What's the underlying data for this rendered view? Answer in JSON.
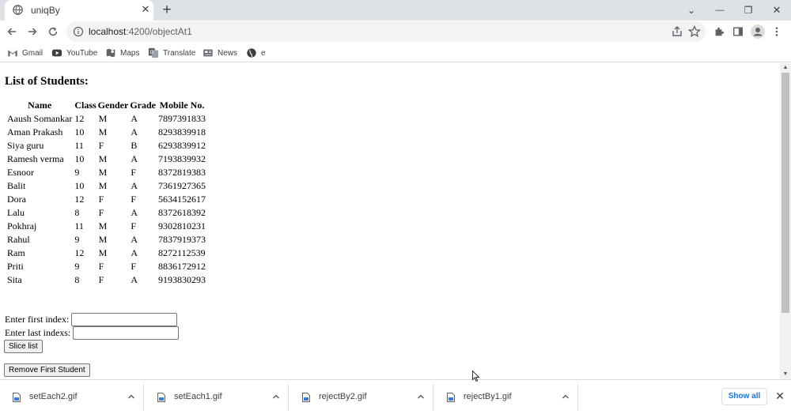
{
  "browser": {
    "tab": {
      "title": "uniqBy",
      "close_glyph": "✕"
    },
    "newtab_glyph": "+",
    "window_controls": {
      "tabsearch_glyph": "⌄",
      "minimize_glyph": "—",
      "restore_glyph": "❐",
      "close_glyph": "✕"
    },
    "url": {
      "host": "localhost",
      "rest": ":4200/objectAt1"
    },
    "bookmarks": [
      {
        "label": "Gmail",
        "icon": "gmail-icon"
      },
      {
        "label": "YouTube",
        "icon": "youtube-icon"
      },
      {
        "label": "Maps",
        "icon": "maps-icon"
      },
      {
        "label": "Translate",
        "icon": "translate-icon"
      },
      {
        "label": "News",
        "icon": "news-icon"
      },
      {
        "label": "e",
        "icon": "globe-icon"
      }
    ]
  },
  "page": {
    "heading": "List of Students:",
    "table": {
      "headers": [
        "Name",
        "Class",
        "Gender",
        "Grade",
        "Mobile No."
      ],
      "rows": [
        [
          "Aaush Somankar",
          "12",
          "M",
          "A",
          "7897391833"
        ],
        [
          "Aman Prakash",
          "10",
          "M",
          "A",
          "8293839918"
        ],
        [
          "Siya guru",
          "11",
          "F",
          "B",
          "6293839912"
        ],
        [
          "Ramesh verma",
          "10",
          "M",
          "A",
          "7193839932"
        ],
        [
          "Esnoor",
          "9",
          "M",
          "F",
          "8372819383"
        ],
        [
          "Balit",
          "10",
          "M",
          "A",
          "7361927365"
        ],
        [
          "Dora",
          "12",
          "F",
          "F",
          "5634152617"
        ],
        [
          "Lalu",
          "8",
          "F",
          "A",
          "8372618392"
        ],
        [
          "Pokhraj",
          "11",
          "M",
          "F",
          "9302810231"
        ],
        [
          "Rahul",
          "9",
          "M",
          "A",
          "7837919373"
        ],
        [
          "Ram",
          "12",
          "M",
          "A",
          "8272112539"
        ],
        [
          "Priti",
          "9",
          "F",
          "F",
          "8836172912"
        ],
        [
          "Sita",
          "8",
          "F",
          "A",
          "9193830293"
        ]
      ]
    },
    "first_index_label": "Enter first index:",
    "first_index_value": "",
    "last_index_label": "Enter last indexs:",
    "last_index_value": "",
    "slice_button": "Slice list",
    "remove_button": "Remove First Student"
  },
  "downloads": {
    "items": [
      {
        "name": "setEach2.gif"
      },
      {
        "name": "setEach1.gif"
      },
      {
        "name": "rejectBy2.gif"
      },
      {
        "name": "rejectBy1.gif"
      }
    ],
    "show_all": "Show all",
    "close_glyph": "✕"
  },
  "colors": {
    "accent": "#1a73e8",
    "tabstrip": "#dee1e6",
    "omnibox": "#f1f3f4"
  }
}
